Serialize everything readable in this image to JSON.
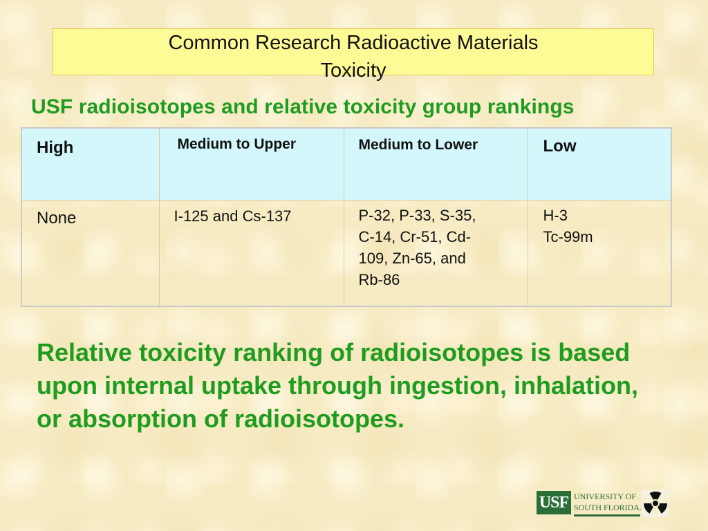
{
  "title": {
    "line1": "Common Research Radioactive Materials",
    "line2": "Toxicity"
  },
  "subtitle": "USF radioisotopes and relative toxicity group rankings",
  "table": {
    "headers": [
      "High",
      "Medium to Upper",
      "Medium to Lower",
      "Low"
    ],
    "rows": [
      {
        "cells": [
          [
            "None"
          ],
          [
            "I-125 and Cs-137"
          ],
          [
            "P-32, P-33, S-35,",
            "C-14, Cr-51, Cd-",
            "109, Zn-65, and",
            "Rb-86"
          ],
          [
            "H-3",
            "Tc-99m"
          ]
        ]
      }
    ]
  },
  "note": "Relative toxicity ranking of radioisotopes is based upon internal uptake through ingestion, inhalation, or absorption of radioisotopes.",
  "logo": {
    "abbrev": "USF",
    "name_line1": "UNIVERSITY OF",
    "name_line2": "SOUTH FLORIDA.",
    "icon": "radiation-trefoil-icon",
    "colors": {
      "brand_green": "#2b6e38",
      "heading_green": "#1f9c1f",
      "title_box": "#fdfb96",
      "header_cells": "#d3f7fb"
    }
  }
}
